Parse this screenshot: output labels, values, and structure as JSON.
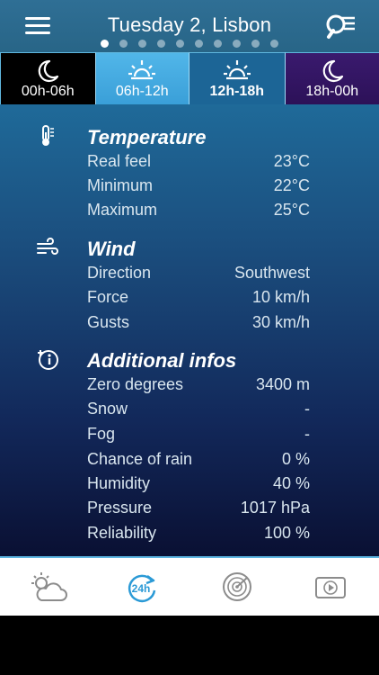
{
  "header": {
    "title": "Tuesday 2, Lisbon",
    "menu_icon": "menu-icon",
    "search_icon": "search-list-icon",
    "page_count": 10,
    "active_page": 0
  },
  "tabs": [
    {
      "label": "00h-06h",
      "icon": "moon-icon"
    },
    {
      "label": "06h-12h",
      "icon": "sunrise-icon"
    },
    {
      "label": "12h-18h",
      "icon": "sunrise-icon",
      "selected": true
    },
    {
      "label": "18h-00h",
      "icon": "moon-icon"
    }
  ],
  "temperature": {
    "title": "Temperature",
    "icon": "thermometer-icon",
    "rows": [
      {
        "label": "Real feel",
        "value": "23°C"
      },
      {
        "label": "Minimum",
        "value": "22°C"
      },
      {
        "label": "Maximum",
        "value": "25°C"
      }
    ]
  },
  "wind": {
    "title": "Wind",
    "icon": "wind-icon",
    "rows": [
      {
        "label": "Direction",
        "value": "Southwest"
      },
      {
        "label": "Force",
        "value": "10 km/h"
      },
      {
        "label": "Gusts",
        "value": "30 km/h"
      }
    ]
  },
  "additional": {
    "title": "Additional infos",
    "icon": "info-plus-icon",
    "rows": [
      {
        "label": "Zero degrees",
        "value": "3400 m"
      },
      {
        "label": "Snow",
        "value": "-"
      },
      {
        "label": "Fog",
        "value": "-"
      },
      {
        "label": "Chance of rain",
        "value": "0 %"
      },
      {
        "label": "Humidity",
        "value": "40 %"
      },
      {
        "label": "Pressure",
        "value": "1017 hPa"
      },
      {
        "label": "Reliability",
        "value": "100 %"
      }
    ]
  },
  "bottom_nav": [
    {
      "icon": "sun-cloud-icon"
    },
    {
      "icon": "24h-icon",
      "label": "24h",
      "active": true
    },
    {
      "icon": "radar-icon"
    },
    {
      "icon": "video-play-icon"
    }
  ],
  "colors": {
    "accent": "#3a9fd8",
    "active_nav": "#2b9ad6",
    "inactive_nav": "#8c8c8c"
  }
}
